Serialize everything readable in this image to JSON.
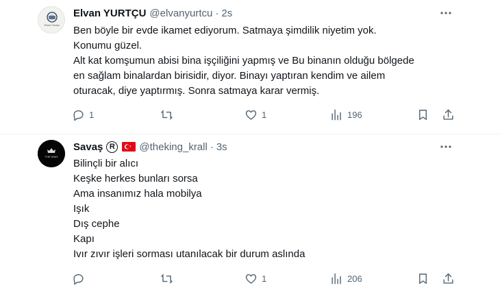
{
  "tweets": [
    {
      "name": "Elvan YURTÇU",
      "handle": "@elvanyurtcu",
      "separator": "·",
      "time": "2s",
      "avatar_text": "Elvan Yurtçu",
      "lines": [
        "Ben böyle bir evde ikamet ediyorum. Satmaya şimdilik niyetim yok.",
        "Konumu güzel.",
        "Alt kat komşumun abisi bina işçiliğini yapmış ve Bu binanın olduğu bölgede",
        "en sağlam binalardan birisidir, diyor. Binayı yaptıran kendim ve ailem",
        "oturacak, diye yaptırmış. Sonra satmaya karar vermiş."
      ],
      "replies": "1",
      "retweets": "",
      "likes": "1",
      "views": "196"
    },
    {
      "name": "Savaş",
      "badge": "R",
      "flag_icon": "turkey-flag-icon",
      "handle": "@theking_krall",
      "separator": "·",
      "time": "3s",
      "avatar_text": "THE KING",
      "lines": [
        "Bilinçli bir alıcı",
        "Keşke herkes bunları sorsa",
        "Ama insanımız hala mobilya",
        "Işık",
        "Dış cephe",
        "Kapı",
        "Ivır zıvır işleri sorması utanılacak bir durum aslında"
      ],
      "replies": "",
      "retweets": "",
      "likes": "1",
      "views": "206"
    }
  ],
  "colors": {
    "text": "#0f1419",
    "muted": "#536471",
    "divider": "#eff3f4",
    "flag_red": "#e30a17"
  }
}
